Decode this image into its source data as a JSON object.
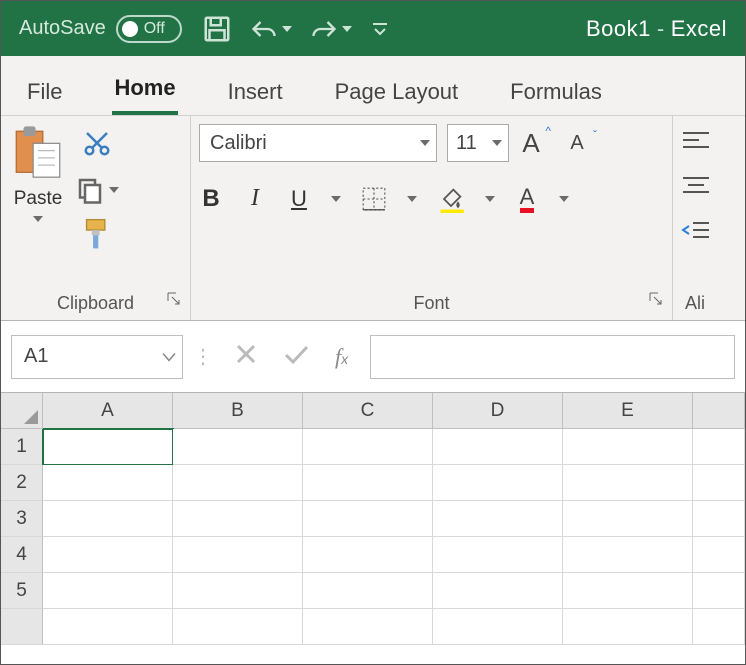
{
  "titlebar": {
    "autosave_label": "AutoSave",
    "autosave_state": "Off",
    "book_name": "Book1",
    "app_name": "Excel"
  },
  "tabs": {
    "file": "File",
    "home": "Home",
    "insert": "Insert",
    "page_layout": "Page Layout",
    "formulas": "Formulas",
    "active": "home"
  },
  "ribbon": {
    "clipboard": {
      "paste": "Paste",
      "label": "Clipboard"
    },
    "font": {
      "name": "Calibri",
      "size": "11",
      "label": "Font"
    },
    "alignment": {
      "label": "Ali"
    }
  },
  "formula_bar": {
    "name_box": "A1",
    "formula": ""
  },
  "grid": {
    "columns": [
      "A",
      "B",
      "C",
      "D",
      "E"
    ],
    "rows": [
      "1",
      "2",
      "3",
      "4",
      "5"
    ],
    "active_cell": "A1"
  }
}
